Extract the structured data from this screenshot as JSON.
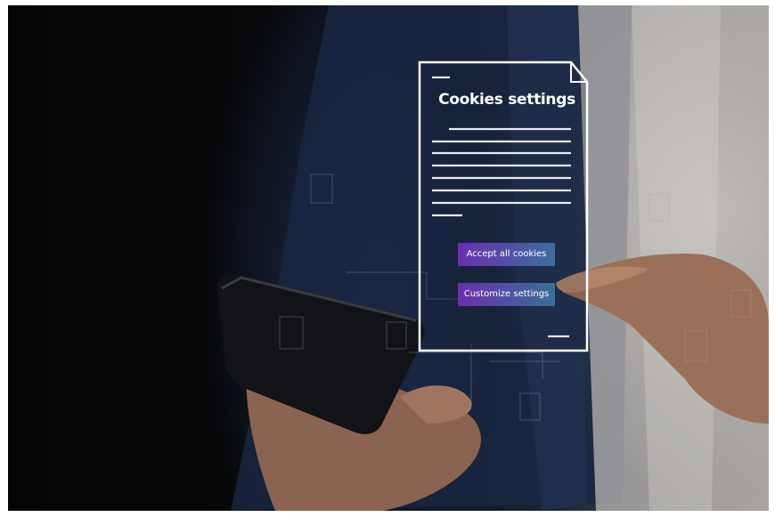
{
  "dialog": {
    "title": "Cookies settings",
    "accept_label": "Accept all cookies",
    "customize_label": "Customize settings"
  },
  "colors": {
    "accent_purple": "#6a2fb0",
    "accent_teal": "#3d6e9e",
    "hologram_line": "#ffffff"
  }
}
